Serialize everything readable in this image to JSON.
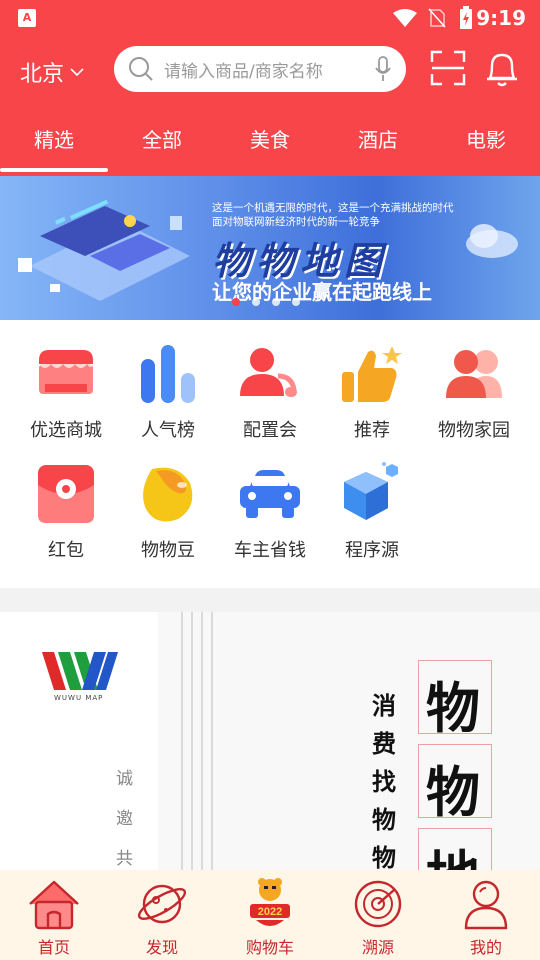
{
  "status_bar": {
    "app_indicator": "A",
    "time": "9:19"
  },
  "header": {
    "city": "北京",
    "search_placeholder": "请输入商品/商家名称",
    "tabs": [
      {
        "label": "精选",
        "active": true
      },
      {
        "label": "全部"
      },
      {
        "label": "美食"
      },
      {
        "label": "酒店"
      },
      {
        "label": "电影"
      }
    ]
  },
  "banner": {
    "line1": "这是一个机遇无限的时代，这是一个充满挑战的时代",
    "line2": "面对物联网新经济时代的新一轮竞争",
    "title": "物物地图",
    "slogan": "让您的企业赢在起跑线上",
    "active_slide_index": 0
  },
  "grid": [
    {
      "label": "优选商城",
      "icon": "shop-icon"
    },
    {
      "label": "人气榜",
      "icon": "bar-chart-icon"
    },
    {
      "label": "配置会",
      "icon": "user-icon"
    },
    {
      "label": "推荐",
      "icon": "thumbs-up-icon"
    },
    {
      "label": "物物家园",
      "icon": "users-icon"
    },
    {
      "label": "红包",
      "icon": "red-envelope-icon"
    },
    {
      "label": "物物豆",
      "icon": "bean-icon"
    },
    {
      "label": "车主省钱",
      "icon": "car-icon"
    },
    {
      "label": "程序源",
      "icon": "cube-icon"
    }
  ],
  "feature": {
    "logo_text": "WUWU MAP",
    "side_chars": [
      "诚",
      "邀",
      "共"
    ],
    "small_chars": [
      "消",
      "费",
      "找",
      "物",
      "物"
    ],
    "big_chars": [
      "物",
      "物",
      "地"
    ]
  },
  "bottom_nav": [
    {
      "label": "首页",
      "icon": "home-icon",
      "active": true
    },
    {
      "label": "发现",
      "icon": "planet-icon"
    },
    {
      "label": "购物车",
      "icon": "tiger-2022-icon"
    },
    {
      "label": "溯源",
      "icon": "radar-icon"
    },
    {
      "label": "我的",
      "icon": "profile-icon"
    }
  ],
  "colors": {
    "brand_red": "#f7454a",
    "nav_red": "#c4282d",
    "nav_bg": "#fff6e8"
  }
}
